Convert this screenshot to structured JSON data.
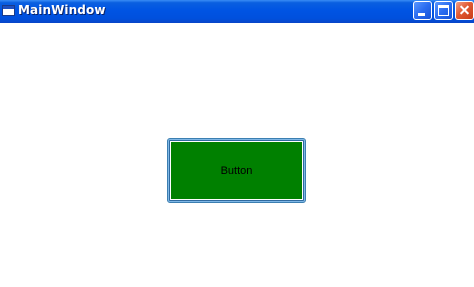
{
  "window": {
    "title": "MainWindow",
    "icon": "app-window-icon",
    "controls": {
      "minimize_icon": "minimize-icon",
      "maximize_icon": "maximize-icon",
      "close_icon": "close-icon"
    },
    "titlebar_color": "#0054e3",
    "client_background": "#ffffff"
  },
  "content": {
    "button": {
      "label": "Button",
      "background": "#008000",
      "border_color": "#3c7fb1"
    }
  }
}
